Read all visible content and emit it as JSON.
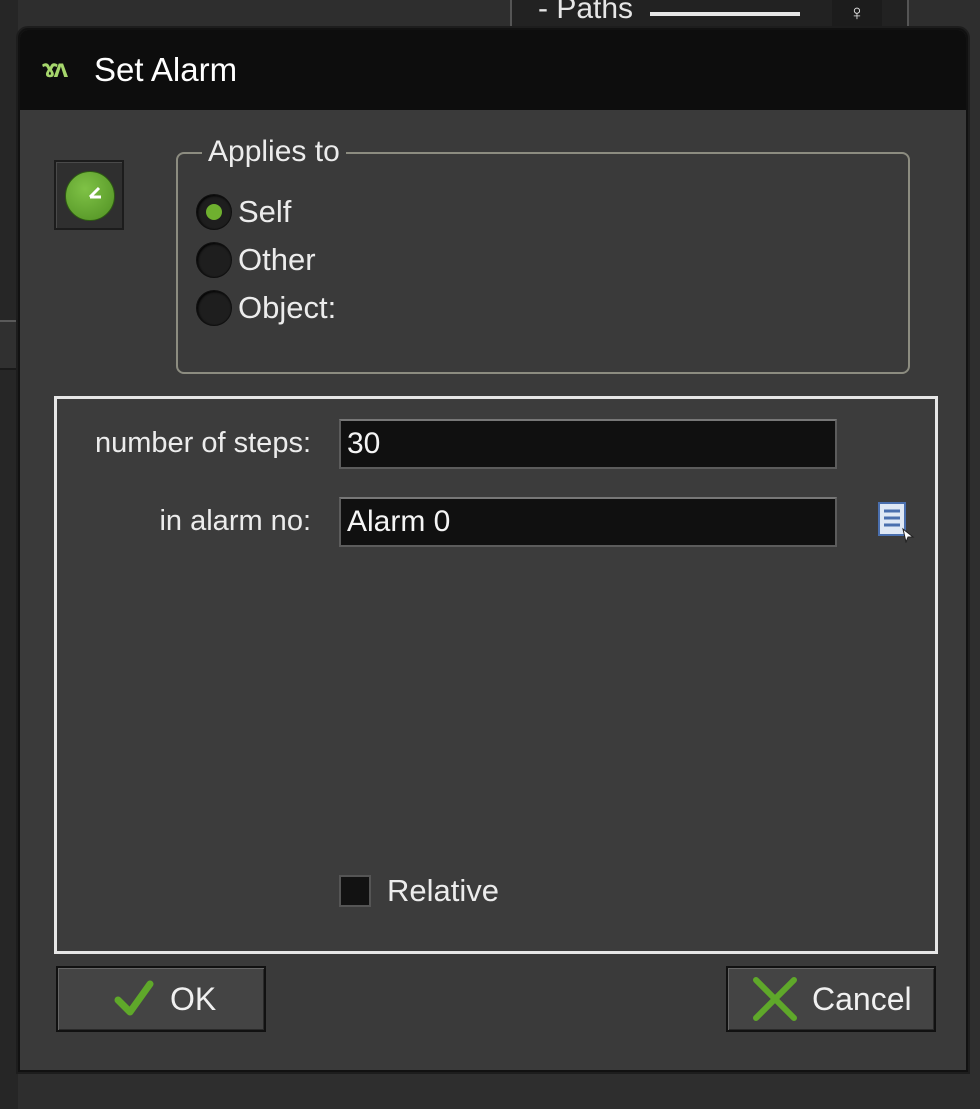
{
  "background": {
    "paths_label": "Paths",
    "paths_box_glyph": "♀"
  },
  "dialog": {
    "title": "Set Alarm",
    "title_logo": "ɤʌ",
    "applies_to": {
      "legend": "Applies to",
      "options": [
        {
          "label": "Self",
          "checked": true
        },
        {
          "label": "Other",
          "checked": false
        },
        {
          "label": "Object:",
          "checked": false
        }
      ]
    },
    "params": {
      "steps_label": "number of steps:",
      "steps_value": "30",
      "alarm_label": "in alarm no:",
      "alarm_value": "Alarm 0",
      "relative_label": "Relative",
      "relative_checked": false
    },
    "buttons": {
      "ok_label": "OK",
      "cancel_label": "Cancel"
    }
  },
  "icons": {
    "action": "alarm-clock-icon",
    "menu": "list-menu-icon",
    "ok": "checkmark-icon",
    "cancel": "cross-icon"
  },
  "colors": {
    "accent_green": "#6fb02f",
    "titlebar": "#0d0d0d",
    "dialog_bg": "#3a3a3a"
  }
}
